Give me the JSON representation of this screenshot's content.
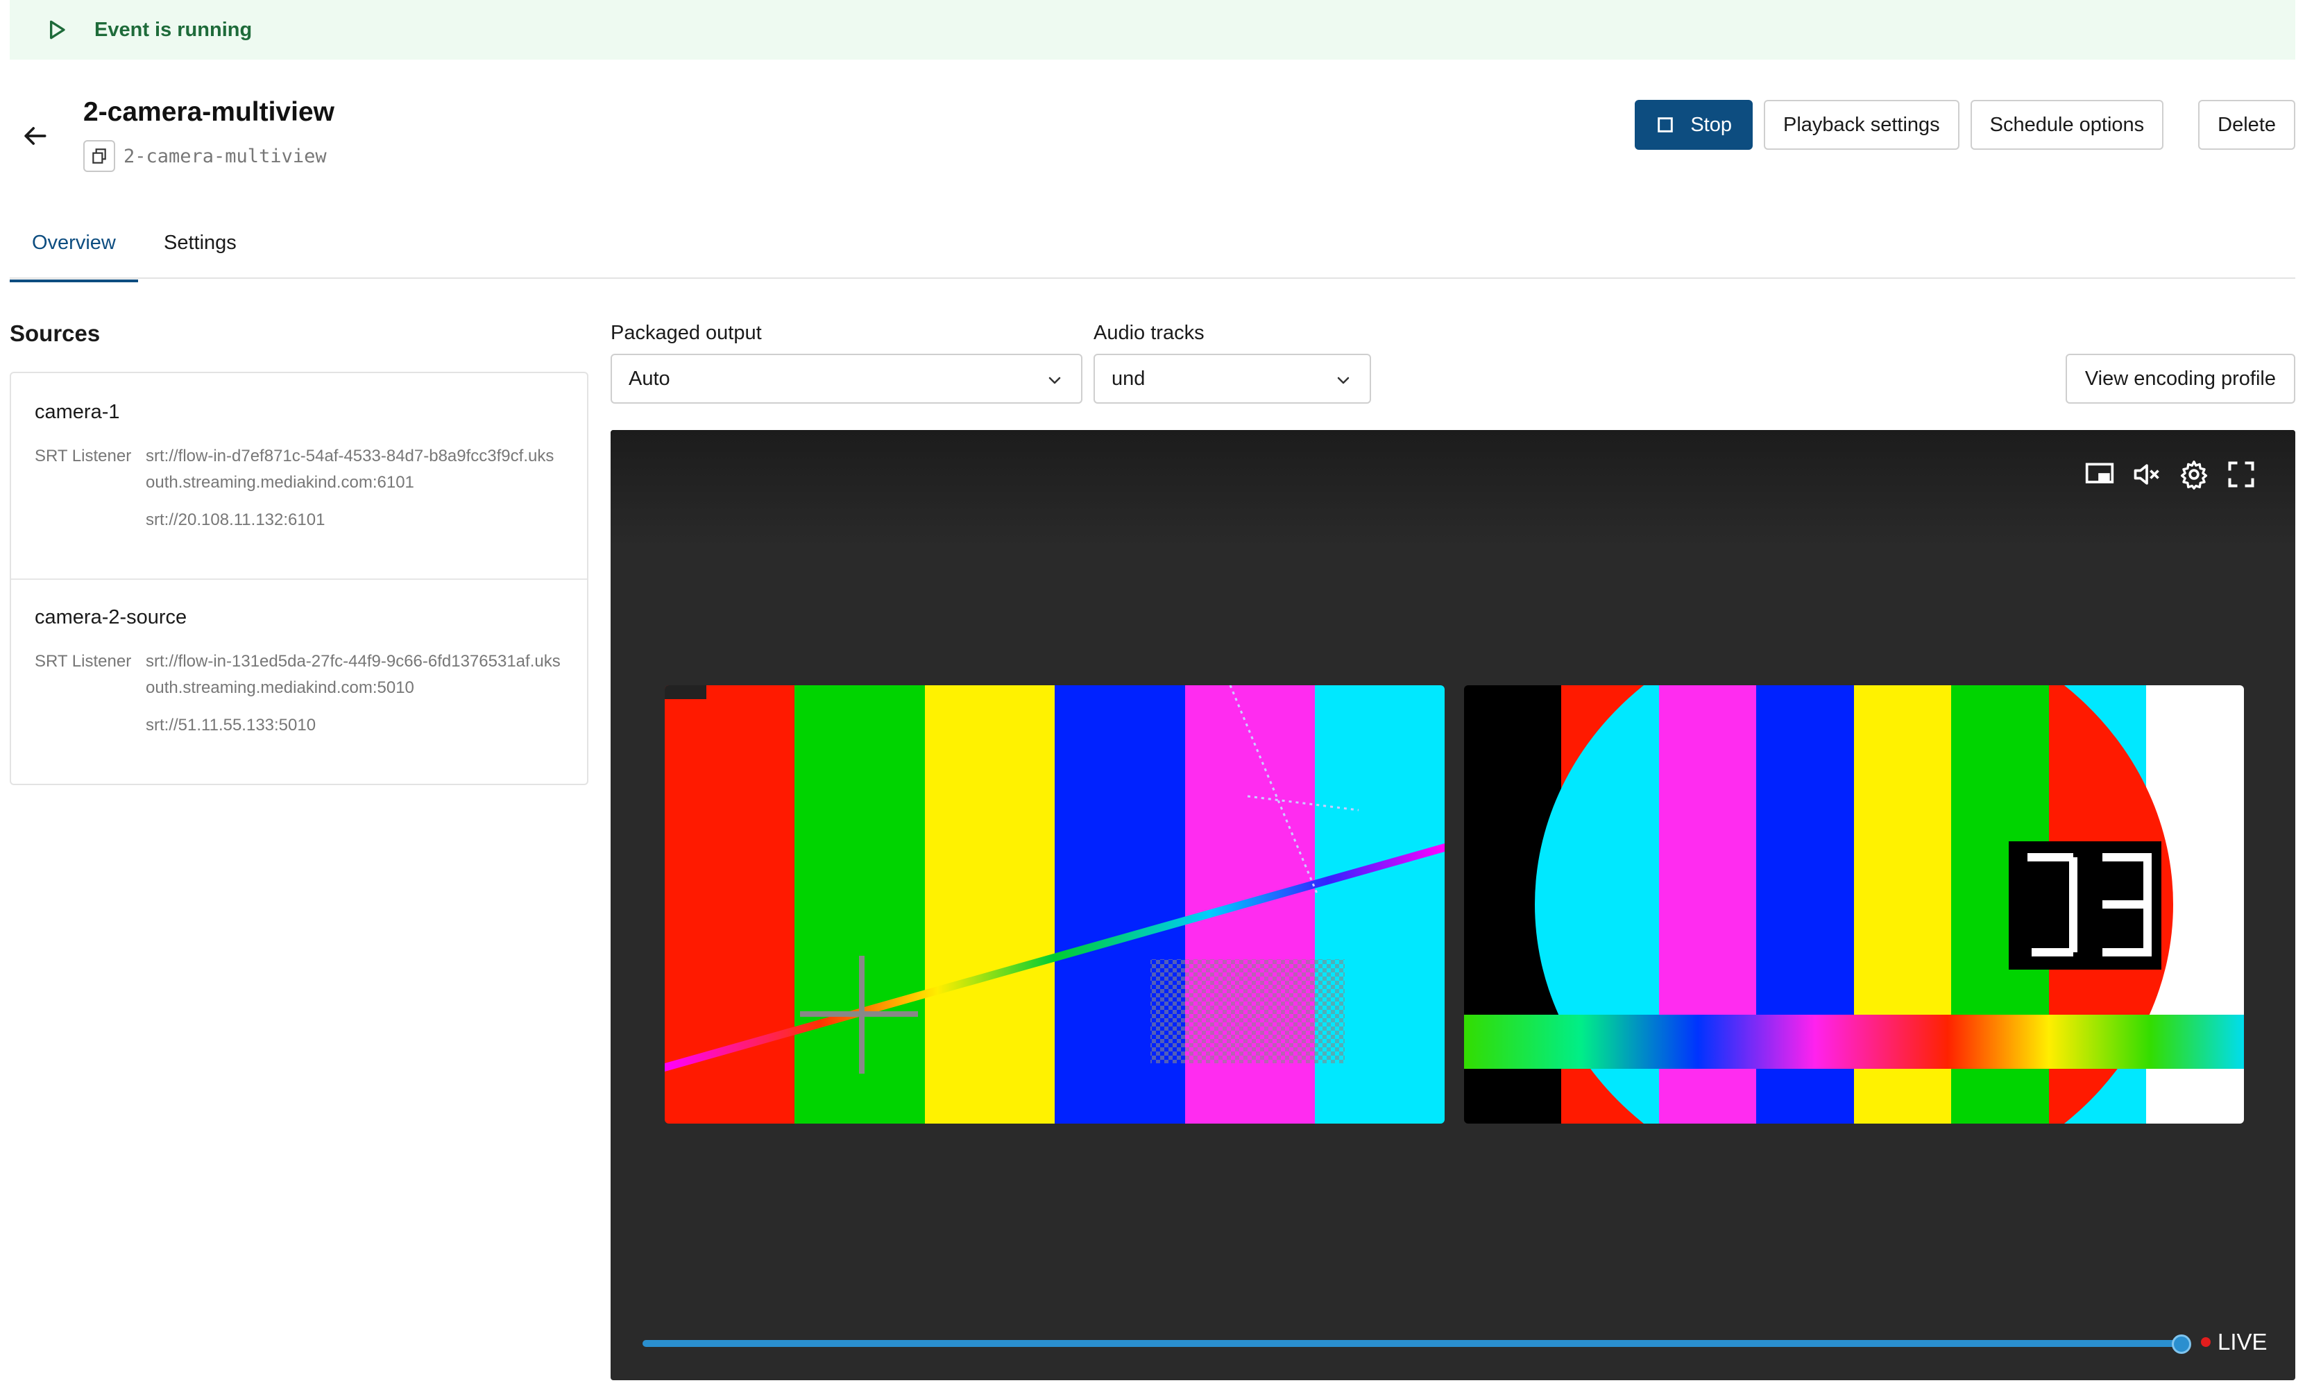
{
  "banner": {
    "status_text": "Event is running",
    "icon": "play-icon",
    "color": "#1e6b3a",
    "background": "#eefaf1"
  },
  "event": {
    "title": "2-camera-multiview",
    "id": "2-camera-multiview"
  },
  "actions": {
    "stop_label": "Stop",
    "playback_label": "Playback settings",
    "schedule_label": "Schedule options",
    "delete_label": "Delete"
  },
  "tabs": [
    {
      "label": "Overview",
      "active": true
    },
    {
      "label": "Settings",
      "active": false
    }
  ],
  "sources": {
    "title": "Sources",
    "items": [
      {
        "name": "camera-1",
        "type": "SRT Listener",
        "url": "srt://flow-in-d7ef871c-54af-4533-84d7-b8a9fcc3f9cf.uksouth.streaming.mediakind.com:6101",
        "ip_url": "srt://20.108.11.132:6101"
      },
      {
        "name": "camera-2-source",
        "type": "SRT Listener",
        "url": "srt://flow-in-131ed5da-27fc-44f9-9c66-6fd1376531af.uksouth.streaming.mediakind.com:5010",
        "ip_url": "srt://51.11.55.133:5010"
      }
    ]
  },
  "output": {
    "packaged_label": "Packaged output",
    "packaged_value": "Auto",
    "audio_label": "Audio tracks",
    "audio_value": "und",
    "view_profile_label": "View encoding profile"
  },
  "player": {
    "controls": [
      "picture-in-picture-icon",
      "mute-icon",
      "gear-icon",
      "fullscreen-icon"
    ],
    "live_label": "LIVE",
    "progress": 1.0,
    "accent": "#2a8fcf"
  },
  "colors": {
    "primary": "#0d4d80",
    "border": "#cfcfcf",
    "live_dot": "#e21d1d"
  }
}
